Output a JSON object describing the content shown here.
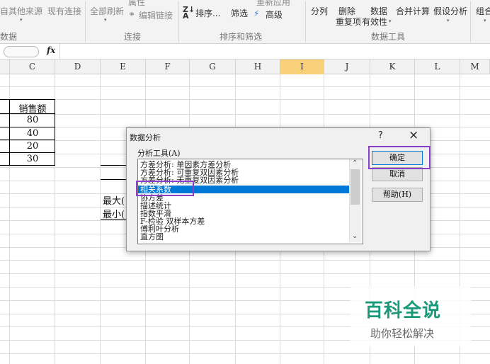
{
  "ribbon": {
    "external_data": "自其他来源",
    "existing_conn": "现有连接",
    "refresh_all": "全部刷新",
    "properties": "属性",
    "edit_links": "编辑链接",
    "sort": "排序...",
    "filter": "筛选",
    "reapply": "重新应用",
    "advanced": "高级",
    "text_to_columns": "分列",
    "remove_duplicates_1": "删除",
    "remove_duplicates_2": "重复项",
    "data_validation_1": "数据",
    "data_validation_2": "有效性",
    "consolidate": "合并计算",
    "what_if": "假设分析",
    "group": "组合",
    "groups": {
      "get_external": "数据",
      "connections": "连接",
      "sort_filter": "排序和筛选",
      "data_tools": "数据工具"
    }
  },
  "formula_bar": {
    "fx": "fx"
  },
  "columns": [
    "C",
    "D",
    "E",
    "F",
    "G",
    "H",
    "I",
    "J",
    "K",
    "L",
    "M"
  ],
  "sheet": {
    "header": "销售额",
    "values": [
      "80",
      "40",
      "20",
      "30"
    ],
    "max_label": "最大(",
    "min_label": "最小("
  },
  "dialog": {
    "title": "数据分析",
    "help_glyph": "?",
    "close_glyph": "×",
    "tools_label": "分析工具(A)",
    "items": [
      "方差分析: 单因素方差分析",
      "方差分析: 可重复双因素分析",
      "方差分析: 无重复双因素分析",
      "相关系数",
      "协方差",
      "描述统计",
      "指数平滑",
      "F-检验 双样本方差",
      "傅利叶分析",
      "直方图"
    ],
    "selected_index": 3,
    "ok": "确定",
    "cancel": "取消",
    "help": "帮助(H)"
  },
  "watermark": {
    "title": "百科全说",
    "subtitle": "助你轻松解决"
  },
  "colors": {
    "selected_item": "#0078d7",
    "highlight_box": "#8a3fc9",
    "watermark_title": "#1a9a7a",
    "selected_column": "#f8d07a"
  }
}
